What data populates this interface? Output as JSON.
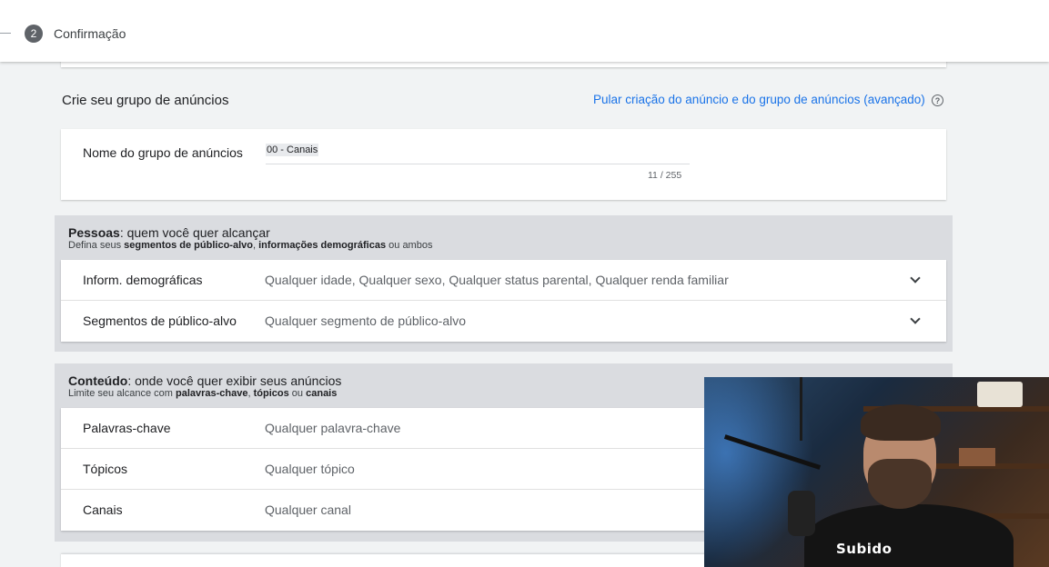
{
  "header": {
    "step_number": "2",
    "step_label": "Confirmação"
  },
  "ad_group": {
    "section_title": "Crie seu grupo de anúncios",
    "skip_link": "Pular criação do anúncio e do grupo de anúncios (avançado)",
    "help_icon_glyph": "?",
    "name_label": "Nome do grupo de anúncios",
    "name_value": "00 - Canais",
    "char_count": "11 / 255"
  },
  "people": {
    "title_bold": "Pessoas",
    "title_rest": ": quem você quer alcançar",
    "sub_pre": "Defina seus ",
    "sub_b1": "segmentos de público-alvo",
    "sub_mid": ", ",
    "sub_b2": "informações demográficas",
    "sub_post": " ou ambos",
    "rows": [
      {
        "label": "Inform. demográficas",
        "value": "Qualquer idade, Qualquer sexo, Qualquer status parental, Qualquer renda familiar"
      },
      {
        "label": "Segmentos de público-alvo",
        "value": "Qualquer segmento de público-alvo"
      }
    ]
  },
  "content": {
    "title_bold": "Conteúdo",
    "title_rest": ": onde você quer exibir seus anúncios",
    "sub_pre": "Limite seu alcance com ",
    "sub_b1": "palavras-chave",
    "sub_mid1": ", ",
    "sub_b2": "tópicos",
    "sub_mid2": " ou ",
    "sub_b3": "canais",
    "rows": [
      {
        "label": "Palavras-chave",
        "value": "Qualquer palavra-chave"
      },
      {
        "label": "Tópicos",
        "value": "Qualquer tópico"
      },
      {
        "label": "Canais",
        "value": "Qualquer canal"
      }
    ]
  },
  "webcam": {
    "shirt_text": "Subido"
  },
  "colors": {
    "accent": "#1a73e8",
    "background": "#f1f3f4",
    "group_bg": "#dadce0"
  }
}
